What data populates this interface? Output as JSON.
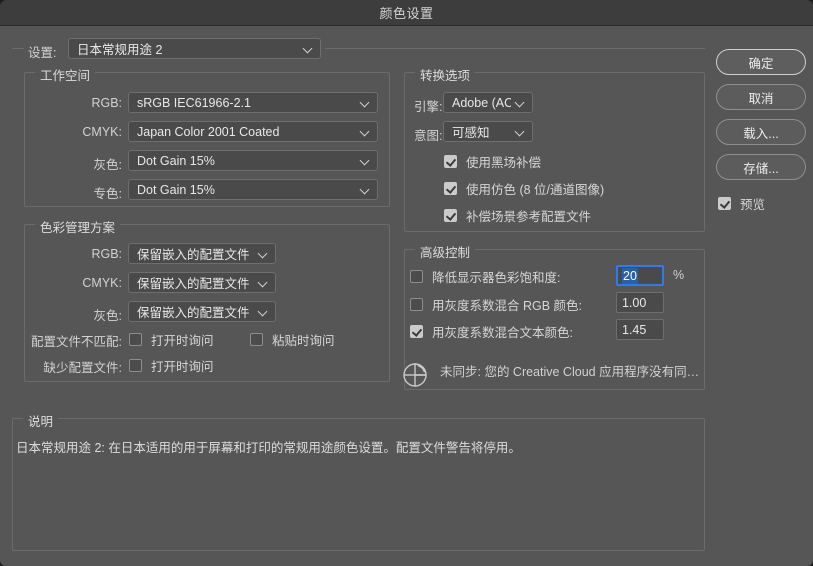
{
  "window": {
    "title": "颜色设置"
  },
  "settings_row": {
    "label": "设置:",
    "value": "日本常规用途 2"
  },
  "working_spaces": {
    "legend": "工作空间",
    "rows": [
      {
        "label": "RGB:",
        "value": "sRGB IEC61966-2.1"
      },
      {
        "label": "CMYK:",
        "value": "Japan Color 2001 Coated"
      },
      {
        "label": "灰色:",
        "value": "Dot Gain 15%"
      },
      {
        "label": "专色:",
        "value": "Dot Gain 15%"
      }
    ]
  },
  "color_management": {
    "legend": "色彩管理方案",
    "rows": [
      {
        "label": "RGB:",
        "value": "保留嵌入的配置文件"
      },
      {
        "label": "CMYK:",
        "value": "保留嵌入的配置文件"
      },
      {
        "label": "灰色:",
        "value": "保留嵌入的配置文件"
      }
    ],
    "mismatch_label": "配置文件不匹配:",
    "mismatch_open": {
      "label": "打开时询问",
      "checked": false
    },
    "mismatch_paste": {
      "label": "粘贴时询问",
      "checked": false
    },
    "missing_label": "缺少配置文件:",
    "missing_open": {
      "label": "打开时询问",
      "checked": false
    }
  },
  "conversion_options": {
    "legend": "转换选项",
    "engine": {
      "label": "引擎:",
      "value": "Adobe (AC..."
    },
    "intent": {
      "label": "意图:",
      "value": "可感知"
    },
    "checkboxes": [
      {
        "label": "使用黑场补偿",
        "checked": true
      },
      {
        "label": "使用仿色 (8 位/通道图像)",
        "checked": true
      },
      {
        "label": "补偿场景参考配置文件",
        "checked": true
      }
    ]
  },
  "advanced_controls": {
    "legend": "高级控制",
    "rows": [
      {
        "label": "降低显示器色彩饱和度:",
        "checked": false,
        "value": "20",
        "suffix": "%",
        "focused": true
      },
      {
        "label": "用灰度系数混合 RGB 颜色:",
        "checked": false,
        "value": "1.00",
        "suffix": "",
        "focused": false
      },
      {
        "label": "用灰度系数混合文本颜色:",
        "checked": true,
        "value": "1.45",
        "suffix": "",
        "focused": false
      }
    ],
    "sync_status": "未同步: 您的 Creative Cloud 应用程序没有同…"
  },
  "description": {
    "legend": "说明",
    "text": "日本常规用途 2: 在日本适用的用于屏幕和打印的常规用途颜色设置。配置文件警告将停用。"
  },
  "buttons": {
    "ok": "确定",
    "cancel": "取消",
    "load": "载入...",
    "save": "存储..."
  },
  "preview": {
    "label": "预览",
    "checked": true
  },
  "colors": {
    "window_bg": "#565656",
    "titlebar_bg": "#3d3d3d",
    "field_bg": "#4a4a4a",
    "border": "#6b6b6b",
    "text": "#d8d8d8",
    "focus_blue": "#2b7de9",
    "selection_blue": "#2b5fa8"
  }
}
